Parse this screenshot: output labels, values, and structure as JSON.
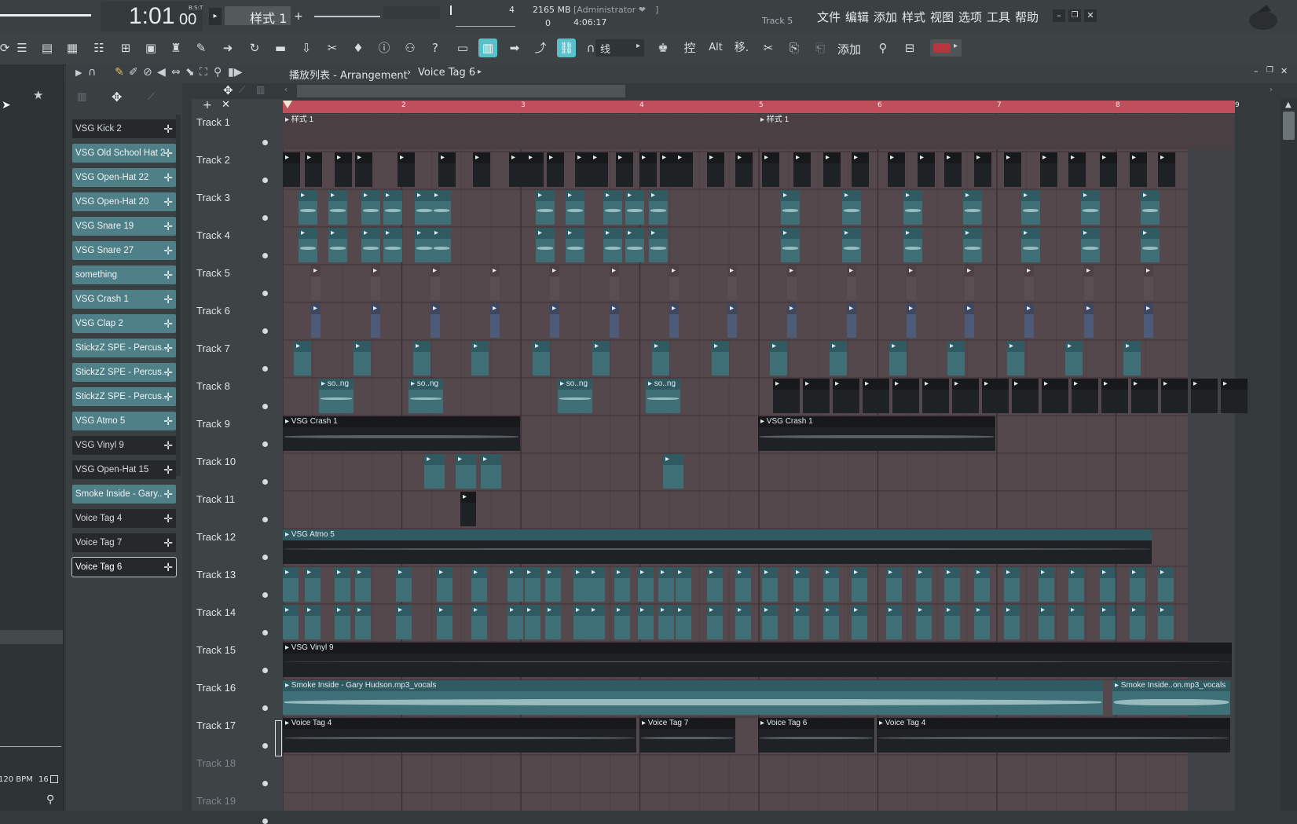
{
  "transport": {
    "time": "1:01",
    "time_sub": "00",
    "time_unit": "B:S:T",
    "pattern": "样式 1"
  },
  "stats": {
    "beats": "4",
    "memory": "2165 MB",
    "cpu": "0",
    "user": "[Administrator ❤",
    "bracket": "]",
    "duration": "4:06:17",
    "hint_track": "Track 5"
  },
  "menu": [
    "文件",
    "编辑",
    "添加",
    "样式",
    "视图",
    "选项",
    "工具",
    "帮助"
  ],
  "toolbar": {
    "mode": "线",
    "ctrl_label": "控",
    "alt_label": "Alt",
    "move_label": "移.",
    "add_label": "添加"
  },
  "playlist": {
    "title": "播放列表 - Arrangement",
    "separator": "›",
    "current": "Voice Tag 6"
  },
  "status": {
    "tempo": "120 BPM",
    "steps": "16"
  },
  "ruler": [
    "2",
    "3",
    "4",
    "5",
    "6",
    "7",
    "8",
    "9"
  ],
  "channels": [
    {
      "name": "VSG Kick 2",
      "style": "dark"
    },
    {
      "name": "VSG Old School Hat 2",
      "style": "teal"
    },
    {
      "name": "VSG Open-Hat 22",
      "style": "teal"
    },
    {
      "name": "VSG Open-Hat 20",
      "style": "teal"
    },
    {
      "name": "VSG Snare 19",
      "style": "teal"
    },
    {
      "name": "VSG Snare 27",
      "style": "teal"
    },
    {
      "name": "something",
      "style": "teal"
    },
    {
      "name": "VSG Crash 1",
      "style": "teal"
    },
    {
      "name": "VSG Clap 2",
      "style": "teal"
    },
    {
      "name": "StickzZ SPE - Percus..",
      "style": "teal"
    },
    {
      "name": "StickzZ SPE - Percus..",
      "style": "teal"
    },
    {
      "name": "StickzZ SPE - Percus..",
      "style": "teal"
    },
    {
      "name": "VSG Atmo 5",
      "style": "teal"
    },
    {
      "name": "VSG Vinyl 9",
      "style": "dark"
    },
    {
      "name": "VSG Open-Hat 15",
      "style": "dark"
    },
    {
      "name": "Smoke Inside - Gary..",
      "style": "teal"
    },
    {
      "name": "Voice Tag 4",
      "style": "dark"
    },
    {
      "name": "Voice Tag 7",
      "style": "dark"
    },
    {
      "name": "Voice Tag 6",
      "style": "sel"
    }
  ],
  "tracks": [
    "Track 1",
    "Track 2",
    "Track 3",
    "Track 4",
    "Track 5",
    "Track 6",
    "Track 7",
    "Track 8",
    "Track 9",
    "Track 10",
    "Track 11",
    "Track 12",
    "Track 13",
    "Track 14",
    "Track 15",
    "Track 16",
    "Track 17",
    "Track 18",
    "Track 19"
  ],
  "clip_labels": {
    "pattern1": "样式 1",
    "song": "so..ng",
    "crash": "VSG Crash 1",
    "atmo": "VSG Atmo 5",
    "vinyl": "VSG Vinyl 9",
    "smoke": "Smoke Inside - Gary Hudson.mp3_vocals",
    "smoke2": "Smoke Inside..on.mp3_vocals",
    "vt4": "Voice Tag 4",
    "vt7": "Voice Tag 7",
    "vt6": "Voice Tag 6",
    "vt4b": "Voice Tag 4"
  },
  "colors": {
    "timeline": "#bf4f5d",
    "teal_clip": "#3f6f77",
    "grid": "#55484c",
    "accent": "#59c0c9"
  }
}
